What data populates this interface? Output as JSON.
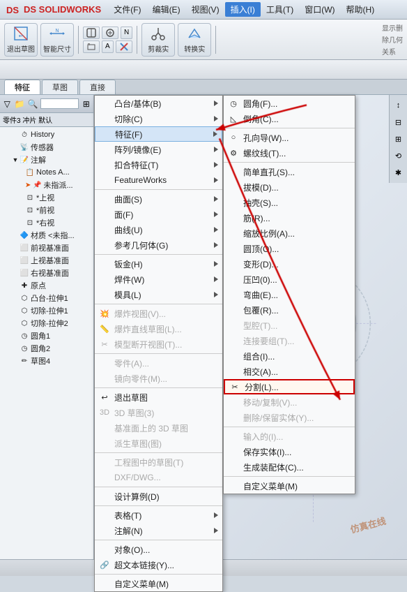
{
  "titlebar": {
    "logo": "DS SOLIDWORKS",
    "menus": [
      "文件(F)",
      "编辑(E)",
      "视图(V)",
      "插入(I)",
      "工具(T)",
      "窗口(W)",
      "帮助(H)"
    ],
    "active_menu": "插入(I)"
  },
  "toolbar": {
    "btn1_label": "退出草图",
    "btn2_label": "智能尺寸",
    "tab_feature": "特征",
    "tab_sketch": "草图",
    "tab_direct": "直接"
  },
  "panel": {
    "title": "零件3 冲片 默认",
    "items": [
      {
        "label": "History",
        "level": 1,
        "icon": "⏱",
        "expanded": false
      },
      {
        "label": "传感器",
        "level": 1,
        "icon": "📡",
        "expanded": false
      },
      {
        "label": "注解",
        "level": 1,
        "icon": "📝",
        "expanded": true
      },
      {
        "label": "Notes A...",
        "level": 2,
        "icon": "📋",
        "expanded": false
      },
      {
        "label": "未指派...",
        "level": 2,
        "icon": "📌",
        "expanded": false,
        "arrow": true
      },
      {
        "label": "*上视",
        "level": 2,
        "icon": "⊡",
        "expanded": false
      },
      {
        "label": "*前视",
        "level": 2,
        "icon": "⊡",
        "expanded": false
      },
      {
        "label": "*右视",
        "level": 2,
        "icon": "⊡",
        "expanded": false
      },
      {
        "label": "材质 <未指...",
        "level": 1,
        "icon": "🔷",
        "expanded": false
      },
      {
        "label": "前视基准面",
        "level": 1,
        "icon": "⬜",
        "expanded": false
      },
      {
        "label": "上视基准面",
        "level": 1,
        "icon": "⬜",
        "expanded": false
      },
      {
        "label": "右视基准面",
        "level": 1,
        "icon": "⬜",
        "expanded": false
      },
      {
        "label": "原点",
        "level": 1,
        "icon": "✚",
        "expanded": false
      },
      {
        "label": "凸台-拉伸1",
        "level": 1,
        "icon": "⬡",
        "expanded": false
      },
      {
        "label": "切除-拉伸1",
        "level": 1,
        "icon": "⬡",
        "expanded": false
      },
      {
        "label": "切除-拉伸2",
        "level": 1,
        "icon": "⬡",
        "expanded": false
      },
      {
        "label": "圆角1",
        "level": 1,
        "icon": "◷",
        "expanded": false
      },
      {
        "label": "圆角2",
        "level": 1,
        "icon": "◷",
        "expanded": false
      },
      {
        "label": "草图4",
        "level": 1,
        "icon": "✏",
        "expanded": false
      }
    ]
  },
  "insert_menu": {
    "items": [
      {
        "label": "凸台/基体(B)",
        "shortcut": "",
        "has_arrow": true,
        "grayed": false,
        "icon": ""
      },
      {
        "label": "切除(C)",
        "shortcut": "",
        "has_arrow": true,
        "grayed": false,
        "icon": ""
      },
      {
        "label": "特征(F)",
        "shortcut": "",
        "has_arrow": true,
        "grayed": false,
        "icon": "",
        "highlighted": true
      },
      {
        "label": "阵列/镜像(E)",
        "shortcut": "",
        "has_arrow": true,
        "grayed": false,
        "icon": ""
      },
      {
        "label": "扣合特征(T)",
        "shortcut": "",
        "has_arrow": true,
        "grayed": false,
        "icon": ""
      },
      {
        "label": "FeatureWorks",
        "shortcut": "",
        "has_arrow": true,
        "grayed": false,
        "icon": ""
      },
      {
        "sep": true
      },
      {
        "label": "曲面(S)",
        "shortcut": "",
        "has_arrow": true,
        "grayed": false,
        "icon": ""
      },
      {
        "label": "面(F)",
        "shortcut": "",
        "has_arrow": true,
        "grayed": false,
        "icon": ""
      },
      {
        "label": "曲线(U)",
        "shortcut": "",
        "has_arrow": true,
        "grayed": false,
        "icon": ""
      },
      {
        "label": "参考几何体(G)",
        "shortcut": "",
        "has_arrow": true,
        "grayed": false,
        "icon": ""
      },
      {
        "sep": true
      },
      {
        "label": "钣金(H)",
        "shortcut": "",
        "has_arrow": true,
        "grayed": false,
        "icon": ""
      },
      {
        "label": "焊件(W)",
        "shortcut": "",
        "has_arrow": true,
        "grayed": false,
        "icon": ""
      },
      {
        "label": "模具(L)",
        "shortcut": "",
        "has_arrow": true,
        "grayed": false,
        "icon": ""
      },
      {
        "sep": true
      },
      {
        "label": "爆炸视图(V)...",
        "shortcut": "",
        "has_arrow": false,
        "grayed": true,
        "icon": "💥"
      },
      {
        "label": "爆炸直线草图(L)...",
        "shortcut": "",
        "has_arrow": false,
        "grayed": true,
        "icon": "📏"
      },
      {
        "label": "模型断开视图(T)...",
        "shortcut": "",
        "has_arrow": false,
        "grayed": true,
        "icon": "✂"
      },
      {
        "sep": true
      },
      {
        "label": "零件(A)...",
        "shortcut": "",
        "has_arrow": false,
        "grayed": true,
        "icon": ""
      },
      {
        "label": "镜向零件(M)...",
        "shortcut": "",
        "has_arrow": false,
        "grayed": true,
        "icon": ""
      },
      {
        "sep": true
      },
      {
        "label": "退出草图",
        "shortcut": "",
        "has_arrow": false,
        "grayed": false,
        "icon": "↩"
      },
      {
        "label": "3D 草图(3)",
        "shortcut": "",
        "has_arrow": false,
        "grayed": true,
        "icon": "3D"
      },
      {
        "label": "基准面上的 3D 草图",
        "shortcut": "",
        "has_arrow": false,
        "grayed": true,
        "icon": ""
      },
      {
        "label": "派生草图(图)",
        "shortcut": "",
        "has_arrow": false,
        "grayed": true,
        "icon": ""
      },
      {
        "sep": true
      },
      {
        "label": "工程图中的草图(T)",
        "shortcut": "",
        "has_arrow": false,
        "grayed": true,
        "icon": ""
      },
      {
        "label": "DXF/DWG...",
        "shortcut": "",
        "has_arrow": false,
        "grayed": true,
        "icon": ""
      },
      {
        "sep": true
      },
      {
        "label": "设计算例(D)",
        "shortcut": "",
        "has_arrow": false,
        "grayed": false,
        "icon": ""
      },
      {
        "sep": true
      },
      {
        "label": "表格(T)",
        "shortcut": "",
        "has_arrow": true,
        "grayed": false,
        "icon": ""
      },
      {
        "label": "注解(N)",
        "shortcut": "",
        "has_arrow": true,
        "grayed": false,
        "icon": ""
      },
      {
        "sep": true
      },
      {
        "label": "对象(O)...",
        "shortcut": "",
        "has_arrow": false,
        "grayed": false,
        "icon": ""
      },
      {
        "label": "超文本链接(Y)...",
        "shortcut": "",
        "has_arrow": false,
        "grayed": false,
        "icon": "🔗"
      },
      {
        "sep": true
      },
      {
        "label": "自定义菜单(M)",
        "shortcut": "",
        "has_arrow": false,
        "grayed": false,
        "icon": ""
      }
    ]
  },
  "feature_submenu": {
    "items": [
      {
        "label": "圆角(F)...",
        "has_arrow": false,
        "grayed": false,
        "icon": "◷"
      },
      {
        "label": "倒角(C)...",
        "has_arrow": false,
        "grayed": false,
        "icon": "◺"
      },
      {
        "sep": true
      },
      {
        "label": "孔向导(W)...",
        "has_arrow": false,
        "grayed": false,
        "icon": "○"
      },
      {
        "label": "螺纹线(T)...",
        "has_arrow": false,
        "grayed": false,
        "icon": "⚙"
      },
      {
        "sep": true
      },
      {
        "label": "简单直孔(S)...",
        "has_arrow": false,
        "grayed": false,
        "icon": ""
      },
      {
        "label": "拔模(D)...",
        "has_arrow": false,
        "grayed": false,
        "icon": ""
      },
      {
        "label": "抽壳(S)...",
        "has_arrow": false,
        "grayed": false,
        "icon": ""
      },
      {
        "label": "筋(R)...",
        "has_arrow": false,
        "grayed": false,
        "icon": ""
      },
      {
        "label": "缩放比例(A)...",
        "has_arrow": false,
        "grayed": false,
        "icon": ""
      },
      {
        "label": "圆顶(O)...",
        "has_arrow": false,
        "grayed": false,
        "icon": ""
      },
      {
        "label": "变形(D)...",
        "has_arrow": false,
        "grayed": false,
        "icon": ""
      },
      {
        "label": "压凹(0)...",
        "has_arrow": false,
        "grayed": false,
        "icon": ""
      },
      {
        "label": "弯曲(E)...",
        "has_arrow": false,
        "grayed": false,
        "icon": ""
      },
      {
        "label": "包覆(R)...",
        "has_arrow": false,
        "grayed": false,
        "icon": ""
      },
      {
        "label": "型腔(T)...",
        "has_arrow": false,
        "grayed": true,
        "icon": ""
      },
      {
        "label": "连接要组(T)...",
        "has_arrow": false,
        "grayed": true,
        "icon": ""
      },
      {
        "label": "组合(I)...",
        "has_arrow": false,
        "grayed": false,
        "icon": ""
      },
      {
        "label": "相交(A)...",
        "has_arrow": false,
        "grayed": false,
        "icon": ""
      },
      {
        "label": "分割(L)...",
        "has_arrow": false,
        "grayed": false,
        "icon": "✂",
        "highlighted": true
      },
      {
        "label": "移动/复制(V)...",
        "has_arrow": false,
        "grayed": true,
        "icon": ""
      },
      {
        "label": "删除/保留实体(Y)...",
        "has_arrow": false,
        "grayed": true,
        "icon": ""
      },
      {
        "sep": true
      },
      {
        "label": "输入的(I)...",
        "has_arrow": false,
        "grayed": true,
        "icon": ""
      },
      {
        "label": "保存实体(I)...",
        "has_arrow": false,
        "grayed": false,
        "icon": ""
      },
      {
        "label": "生成装配体(C)...",
        "has_arrow": false,
        "grayed": false,
        "icon": ""
      },
      {
        "sep": true
      },
      {
        "label": "自定义菜单(M)",
        "has_arrow": false,
        "grayed": false,
        "icon": ""
      }
    ]
  },
  "statusbar": {
    "text": ""
  },
  "watermark": "仿真在线"
}
